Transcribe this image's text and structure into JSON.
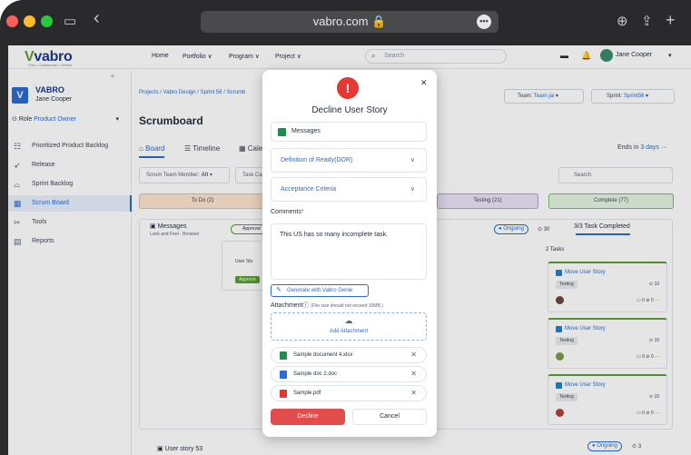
{
  "browser": {
    "url": "vabro.com",
    "colors": {
      "close": "#ff5f57",
      "minimize": "#febc2e",
      "maximize": "#28c840"
    }
  },
  "topnav": {
    "logo": "vabro",
    "logo_tagline": "Plan • Collaborate • Deliver",
    "links": [
      "Home",
      "Portfolio ∨",
      "Program ∨",
      "Project ∨"
    ],
    "search_placeholder": "Search",
    "user": "Jane Cooper"
  },
  "sidebar": {
    "org_initial": "V",
    "org_name": "VABRO",
    "org_user": "Jane Cooper",
    "role_label": "Role",
    "role_value": "Product Owner",
    "items": [
      {
        "label": "Prioritized Product Backlog",
        "icon": "backlog-icon"
      },
      {
        "label": "Release",
        "icon": "rocket-icon"
      },
      {
        "label": "Sprint Backlog",
        "icon": "sprint-icon"
      },
      {
        "label": "Scrum Board",
        "icon": "board-icon",
        "active": true
      },
      {
        "label": "Tools",
        "icon": "tools-icon"
      },
      {
        "label": "Reports",
        "icon": "reports-icon"
      }
    ]
  },
  "main": {
    "breadcrumb": "Projects / Vabro Design / Sprint 56 / Scrumb",
    "title": "Scrumboard",
    "team_label": "Team:",
    "team_value": "Team jai",
    "sprint_label": "Sprint:",
    "sprint_value": "Sprint56",
    "tabs": [
      "Board",
      "Timeline",
      "Cale"
    ],
    "ends_label": "Ends in",
    "ends_value": "3 days",
    "filter_member": "Scrum Team Member:",
    "filter_member_value": "All",
    "filter_task": "Task Ca",
    "search_placeholder": "Search",
    "columns": [
      "To Do (2)",
      "Testing (21)",
      "Complete (77)"
    ],
    "story1": {
      "title": "Messages",
      "subtitle": "Look and Feel - Browser",
      "status": "Ongoing",
      "count": "30",
      "tasks_completed": "3/3 Task Completed",
      "approval": "Approval",
      "card_text": "User Sto",
      "card_btn": "Approve"
    },
    "tasks_count": "2 Tasks",
    "task_cards": [
      {
        "title": "Move User Story",
        "tag": "Testing",
        "points": "10",
        "comments": "0",
        "links": "0"
      },
      {
        "title": "Move User Story",
        "tag": "Testing",
        "points": "10",
        "comments": "0",
        "links": "0"
      },
      {
        "title": "Move User Story",
        "tag": "Testing",
        "points": "10",
        "comments": "0",
        "links": "0"
      }
    ],
    "story2": {
      "title": "User story 53",
      "status": "Ongoing",
      "count": "3"
    }
  },
  "modal": {
    "title": "Decline User Story",
    "selected_item": "Messages",
    "accordions": [
      "Definition of Ready(DOR)",
      "Acceptance Criteria"
    ],
    "comments_label": "Comments",
    "comments_required": "*",
    "comment_text": "This US has so many incomplete task.",
    "genie_button": "Generate with Vabro Genie",
    "attachment_label": "Attachment",
    "attachment_note": "(File size should not exceed 10MB.)",
    "add_attachment": "Add Attachment",
    "files": [
      {
        "name": "Sample document 4.xlsx",
        "color": "#1e8e4a"
      },
      {
        "name": "Sample doc 2.doc",
        "color": "#2a6bd4"
      },
      {
        "name": "Sample.pdf",
        "color": "#e53935"
      }
    ],
    "decline_button": "Decline",
    "cancel_button": "Cancel"
  }
}
